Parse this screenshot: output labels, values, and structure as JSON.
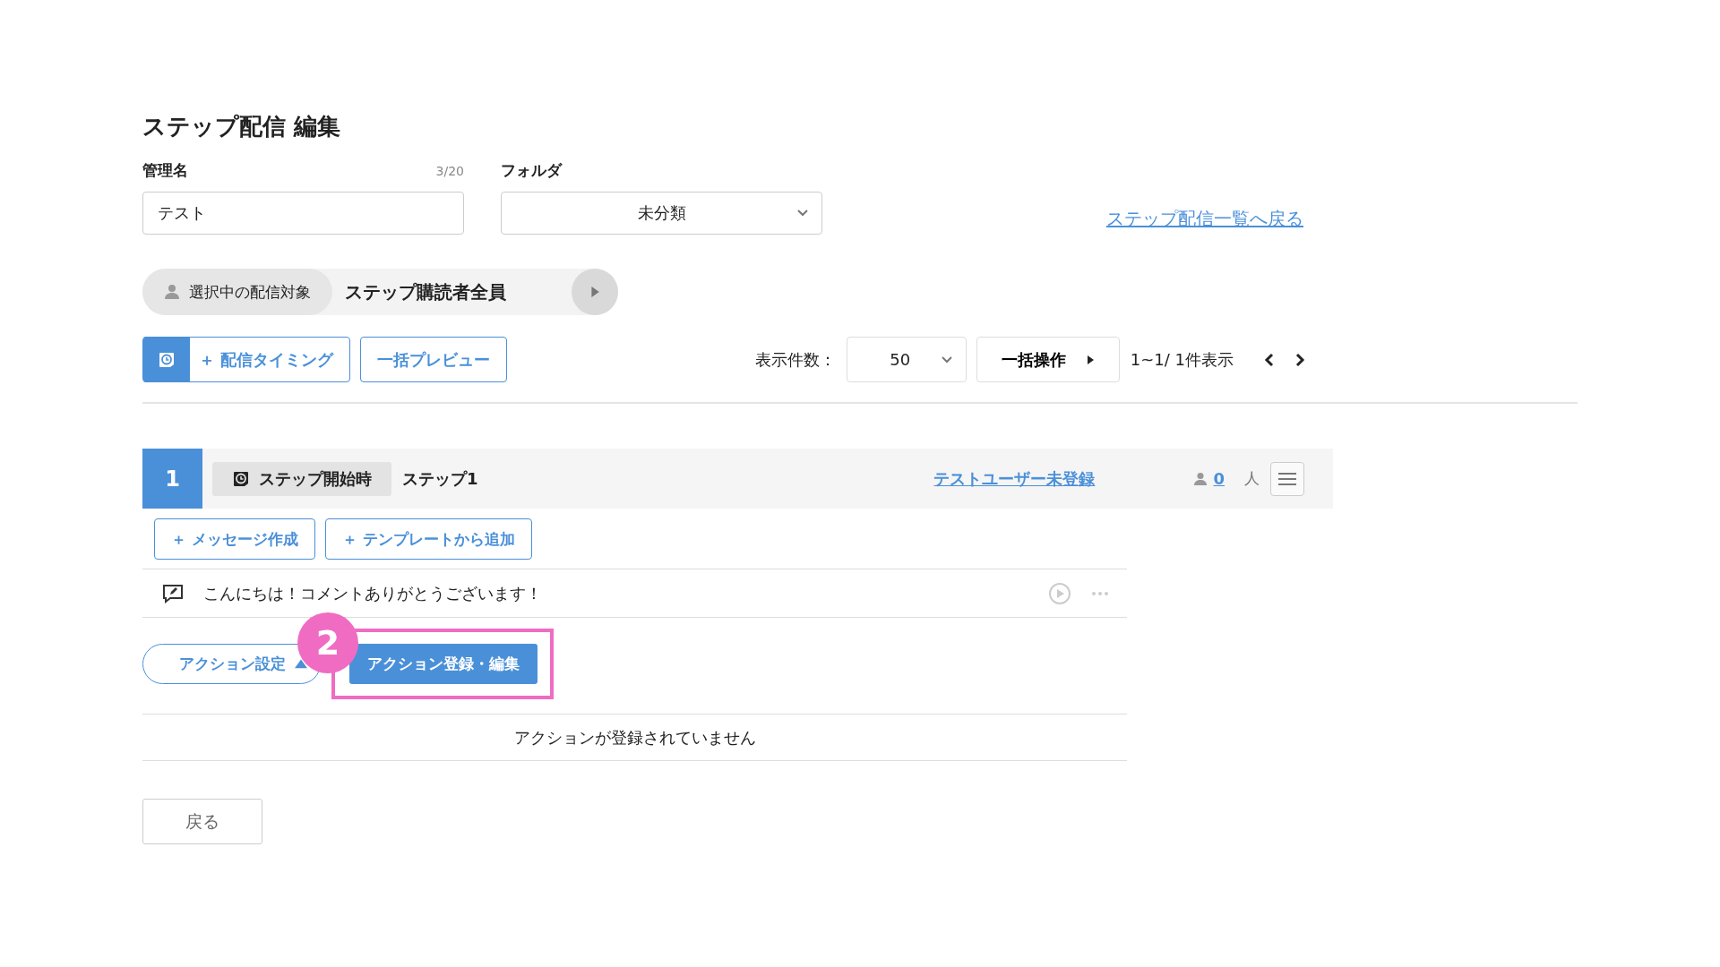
{
  "page_title": "ステップ配信 編集",
  "name_field": {
    "label": "管理名",
    "counter": "3/20",
    "value": "テスト"
  },
  "folder_field": {
    "label": "フォルダ",
    "value": "未分類"
  },
  "back_to_list_link": "ステップ配信一覧へ戻る",
  "target": {
    "label": "選択中の配信対象",
    "value": "ステップ購読者全員"
  },
  "toolbar": {
    "timing_button": "＋ 配信タイミング",
    "preview_button": "一括プレビュー",
    "per_page_label": "表示件数：",
    "per_page_value": "50",
    "bulk_button": "一括操作",
    "paging": "1~1/ 1件表示"
  },
  "step": {
    "number": "1",
    "timing": "ステップ開始時",
    "name": "ステップ1",
    "test_user_link": "テストユーザー未登録",
    "user_count": "0",
    "user_unit": "人",
    "add_buttons": [
      "＋ メッセージ作成",
      "＋ テンプレートから追加"
    ],
    "messages": [
      {
        "text": "こんにちは！コメントありがとうございます！"
      }
    ],
    "action_settings": {
      "label": "アクション設定",
      "expanded": true
    },
    "action_edit_button": "アクション登録・編集",
    "no_actions": "アクションが登録されていません"
  },
  "back_button": "戻る",
  "annotation": {
    "label": "2"
  }
}
